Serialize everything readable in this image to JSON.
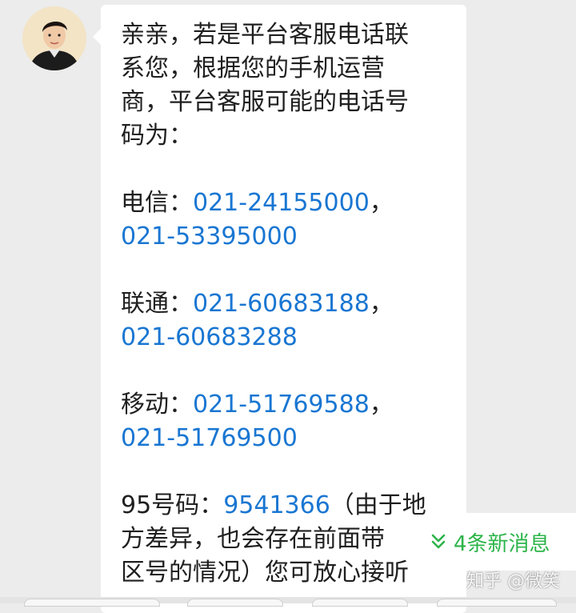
{
  "chat": {
    "avatar_icon": "user-avatar-photo",
    "lines": [
      {
        "segments": [
          {
            "text": "亲亲，若是平台客服电话联",
            "type": "text"
          }
        ]
      },
      {
        "segments": [
          {
            "text": "系您，根据您的手机运营",
            "type": "text"
          }
        ]
      },
      {
        "segments": [
          {
            "text": "商，平台客服可能的电话号",
            "type": "text"
          }
        ]
      },
      {
        "segments": [
          {
            "text": "码为：",
            "type": "text"
          }
        ]
      },
      {
        "blank": true
      },
      {
        "segments": [
          {
            "text": "电信：",
            "type": "text"
          },
          {
            "text": "021-24155000",
            "type": "link"
          },
          {
            "text": "，",
            "type": "text"
          }
        ]
      },
      {
        "segments": [
          {
            "text": "021-53395000",
            "type": "link"
          }
        ]
      },
      {
        "blank": true
      },
      {
        "segments": [
          {
            "text": "联通：",
            "type": "text"
          },
          {
            "text": "021-60683188",
            "type": "link"
          },
          {
            "text": "，",
            "type": "text"
          }
        ]
      },
      {
        "segments": [
          {
            "text": "021-60683288",
            "type": "link"
          }
        ]
      },
      {
        "blank": true
      },
      {
        "segments": [
          {
            "text": "移动：",
            "type": "text"
          },
          {
            "text": "021-51769588",
            "type": "link"
          },
          {
            "text": "，",
            "type": "text"
          }
        ]
      },
      {
        "segments": [
          {
            "text": "021-51769500",
            "type": "link"
          }
        ]
      },
      {
        "blank": true
      },
      {
        "segments": [
          {
            "text": "95号码：",
            "type": "text"
          },
          {
            "text": "9541366",
            "type": "link"
          },
          {
            "text": "（由于地",
            "type": "text"
          }
        ]
      },
      {
        "segments": [
          {
            "text": "方差异，也会存在前面带",
            "type": "text"
          }
        ]
      },
      {
        "segments": [
          {
            "text": "区号的情况）您可放心接听",
            "type": "text"
          }
        ]
      }
    ]
  },
  "new_messages": {
    "label": "4条新消息",
    "icon": "double-chevron-down-icon"
  },
  "watermark": {
    "text": "知乎 @微笑"
  },
  "colors": {
    "link": "#1976d2",
    "new_message": "#2cb449",
    "background": "#ececec",
    "bubble": "#ffffff"
  }
}
